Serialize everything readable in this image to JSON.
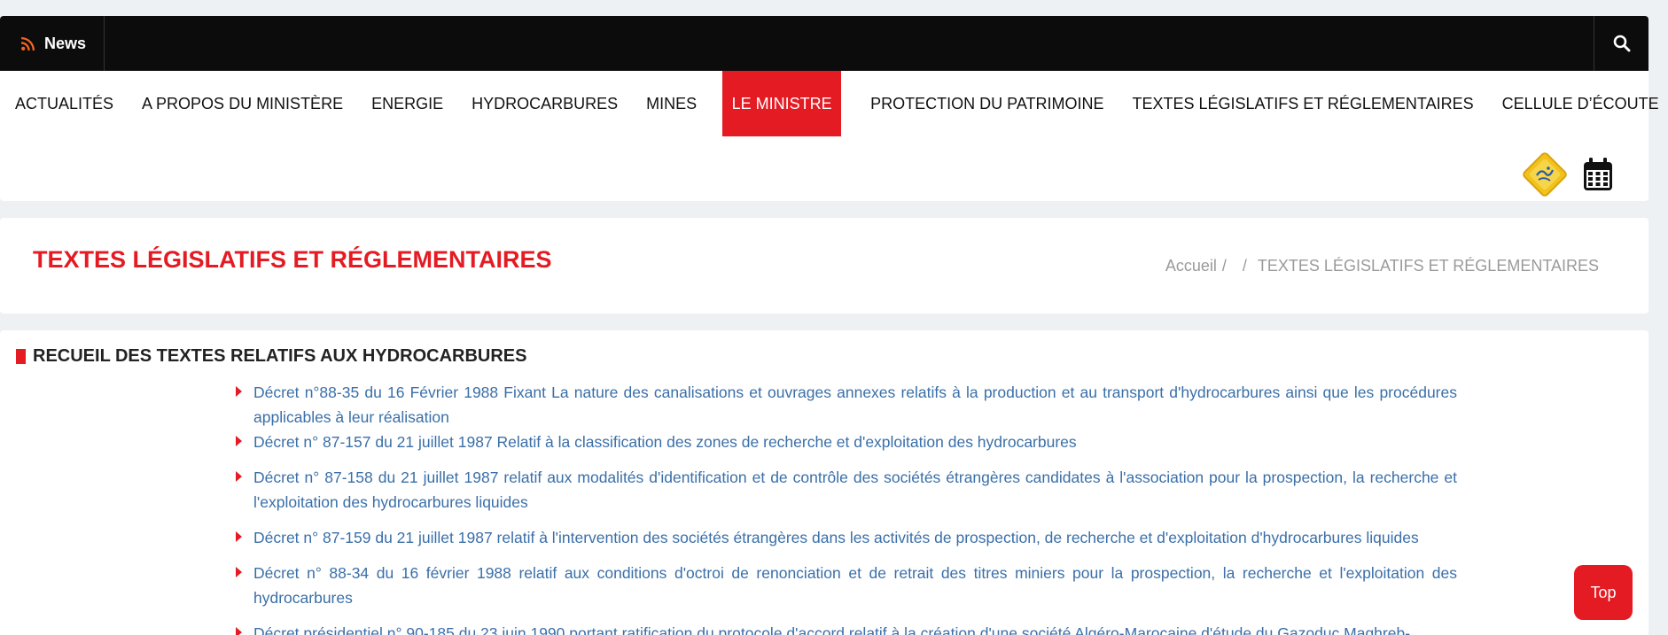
{
  "topbar": {
    "news_label": "News",
    "rss_icon": "rss-icon",
    "search_icon": "search-icon"
  },
  "nav": {
    "items": [
      {
        "label": "ACTUALITÉS"
      },
      {
        "label": "A PROPOS DU MINISTÈRE"
      },
      {
        "label": "ENERGIE"
      },
      {
        "label": "HYDROCARBURES"
      },
      {
        "label": "MINES"
      },
      {
        "label": "LE MINISTRE",
        "active": true
      },
      {
        "label": "PROTECTION DU PATRIMOINE"
      },
      {
        "label": "TEXTES LÉGISLATIFS ET RÉGLEMENTAIRES"
      },
      {
        "label": "CELLULE D’ÉCOUTE"
      }
    ],
    "icons": [
      "emblem-badge-icon",
      "calendar-icon"
    ]
  },
  "page": {
    "title": "TEXTES LÉGISLATIFS ET RÉGLEMENTAIRES",
    "breadcrumb": {
      "home": "Accueil",
      "sep1": "/",
      "sep2": "/",
      "current": "TEXTES LÉGISLATIFS ET RÉGLEMENTAIRES"
    }
  },
  "section": {
    "title": "RECUEIL DES TEXTES RELATIFS AUX HYDROCARBURES",
    "documents": [
      {
        "text": "Décret n°88-35 du 16 Février 1988 Fixant La nature des canalisations et ouvrages annexes relatifs à la production et au transport d'hydrocarbures ainsi que les procédures applicables à leur réalisation"
      },
      {
        "text": "Décret n° 87-157 du 21 juillet 1987 Relatif à la classification des zones de recherche et d'exploitation des hydrocarbures"
      },
      {
        "text": "Décret n° 87-158 du 21 juillet 1987 relatif aux modalités d'identification et de contrôle des sociétés étrangères candidates à  l'association pour la prospection, la recherche et l'exploitation des hydrocarbures liquides"
      },
      {
        "text": "Décret n° 87-159 du 21 juillet 1987 relatif à  l'intervention des sociétés étrangères dans les activités de prospection, de recherche et d'exploitation d'hydrocarbures liquides"
      },
      {
        "text": "Décret n° 88-34 du 16 février 1988 relatif aux conditions d'octroi de renonciation et de retrait des titres miniers pour la prospection, la recherche et l'exploitation des hydrocarbures"
      },
      {
        "text": "Décret présidentiel n° 90-185 du 23 juin 1990 portant ratification du protocole d'accord relatif à  la création d'une société Algéro-Marocaine d'étude du Gazoduc Maghreb-"
      }
    ]
  },
  "top_button": {
    "label": "Top"
  },
  "colors": {
    "accent": "#e41b23",
    "link": "#3a6fa8",
    "topbar": "#0c0c0c"
  }
}
